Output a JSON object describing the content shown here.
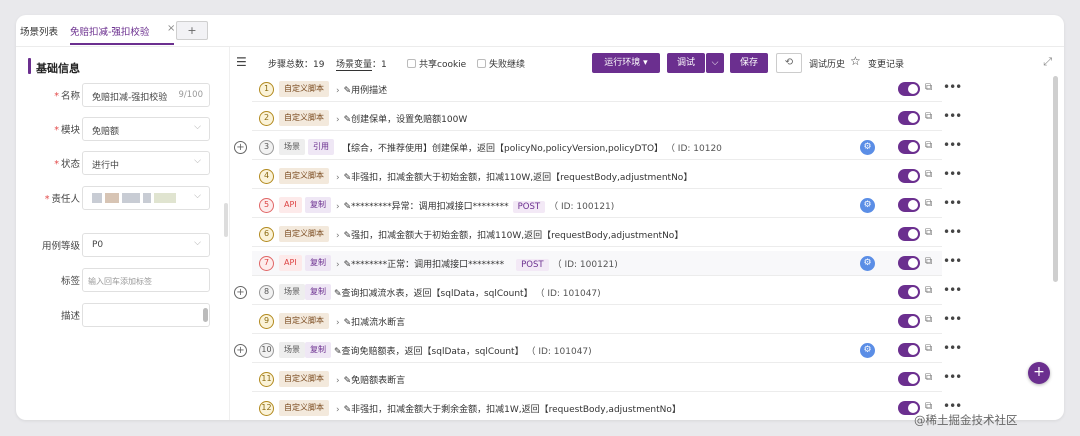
{
  "tabs": {
    "list_label": "场景列表",
    "active_label": "免赔扣减-强扣校验",
    "close_symbol": "×",
    "add_symbol": "+"
  },
  "form": {
    "section_title": "基础信息",
    "required_mark": "*",
    "fields": {
      "name": {
        "label": "名称",
        "value": "免赔扣减-强扣校验",
        "count": "9/100"
      },
      "module": {
        "label": "模块",
        "value": "免赔额"
      },
      "status": {
        "label": "状态",
        "value": "进行中"
      },
      "owner": {
        "label": "责任人"
      },
      "level": {
        "label": "用例等级",
        "value": "P0"
      },
      "tags": {
        "label": "标签",
        "placeholder": "输入回车添加标签"
      },
      "desc": {
        "label": "描述"
      }
    }
  },
  "toolbar": {
    "step_count_label": "步骤总数：",
    "step_count": "19",
    "scene_vars_label": "场景变量",
    "scene_vars_count": "：1",
    "share_cookie": "共享cookie",
    "continue_on_fail": "失败继续",
    "env_button": "运行环境 ▾",
    "debug_button": "调试",
    "save_button": "保存",
    "history_label": "调试历史",
    "changelog_label": "变更记录"
  },
  "steps": [
    {
      "n": "1",
      "tag": "自定义脚本",
      "text": "用例描述"
    },
    {
      "n": "2",
      "tag": "自定义脚本",
      "text": "创建保单，设置免赔额100W"
    },
    {
      "n": "3",
      "tag": "场景",
      "tag2": "引用",
      "text": "【综合，不推荐使用】创建保单，返回【policyNo,policyVersion,policyDTO】",
      "id": "（ ID: 10120"
    },
    {
      "n": "4",
      "tag": "自定义脚本",
      "text": "非强扣，扣减金额大于初始金额，扣减110W,返回【requestBody,adjustmentNo】"
    },
    {
      "n": "5",
      "tag": "API",
      "tag2": "复制",
      "text": "*********异常：调用扣减接口********",
      "method": "POST",
      "id": "（ ID: 100121)"
    },
    {
      "n": "6",
      "tag": "自定义脚本",
      "text": "强扣，扣减金额大于初始金额，扣减110W,返回【requestBody,adjustmentNo】"
    },
    {
      "n": "7",
      "tag": "API",
      "tag2": "复制",
      "text": "********正常：调用扣减接口********",
      "method": "POST",
      "id": "（ ID: 100121)"
    },
    {
      "n": "8",
      "tag": "场景",
      "tag2": "复制",
      "text": "查询扣减流水表，返回【sqlData，sqlCount】",
      "id": "（ ID: 101047)"
    },
    {
      "n": "9",
      "tag": "自定义脚本",
      "text": "扣减流水断言"
    },
    {
      "n": "10",
      "tag": "场景",
      "tag2": "复制",
      "text": "查询免赔额表，返回【sqlData，sqlCount】",
      "id": "（ ID: 101047)"
    },
    {
      "n": "11",
      "tag": "自定义脚本",
      "text": "免赔额表断言"
    },
    {
      "n": "12",
      "tag": "自定义脚本",
      "text": "非强扣，扣减金额大于剩余金额，扣减1W,返回【requestBody,adjustmentNo】"
    }
  ],
  "watermark": "@稀土掘金技术社区",
  "colors": {
    "accent": "#6b2f8f",
    "sync": "#5b8ee6",
    "api_red": "#dd4444"
  }
}
